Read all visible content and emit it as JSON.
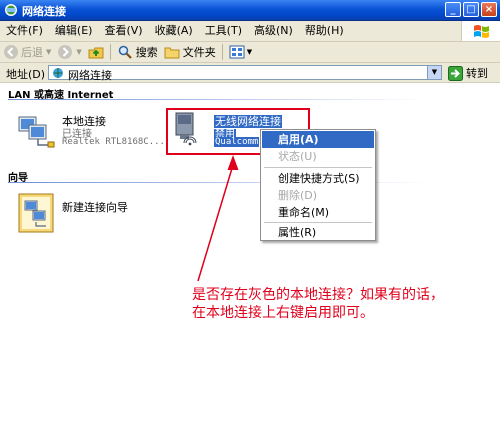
{
  "window": {
    "title": "网络连接",
    "controls": [
      "_",
      "□",
      "×"
    ]
  },
  "menubar": {
    "items": [
      "文件(F)",
      "编辑(E)",
      "查看(V)",
      "收藏(A)",
      "工具(T)",
      "高级(N)",
      "帮助(H)"
    ]
  },
  "toolbar": {
    "back_label": "后退",
    "search_label": "搜索",
    "folders_label": "文件夹"
  },
  "address": {
    "label": "地址(D)",
    "value": "网络连接",
    "go_label": "转到"
  },
  "sections": {
    "lan_title": "LAN 或高速 Internet",
    "wizard_title": "向导"
  },
  "connections": [
    {
      "name": "本地连接",
      "status": "已连接",
      "device": "Realtek RTL8168C..."
    },
    {
      "name": "无线网络连接",
      "status": "禁用",
      "device": "Qualcomm"
    }
  ],
  "wizard": {
    "name": "新建连接向导"
  },
  "context_menu": {
    "items": [
      {
        "label": "启用(A)",
        "state": "highlighted"
      },
      {
        "label": "状态(U)",
        "state": "disabled"
      },
      {
        "label": "创建快捷方式(S)",
        "state": "normal"
      },
      {
        "label": "删除(D)",
        "state": "disabled"
      },
      {
        "label": "重命名(M)",
        "state": "normal"
      },
      {
        "label": "属性(R)",
        "state": "normal"
      }
    ]
  },
  "annotation": {
    "line1": "是否存在灰色的本地连接？如果有的话，",
    "line2": "在本地连接上右键启用即可。"
  },
  "colors": {
    "titlebar": "#0a53d6",
    "highlight": "#316ac5",
    "annotation": "#e0001b"
  }
}
